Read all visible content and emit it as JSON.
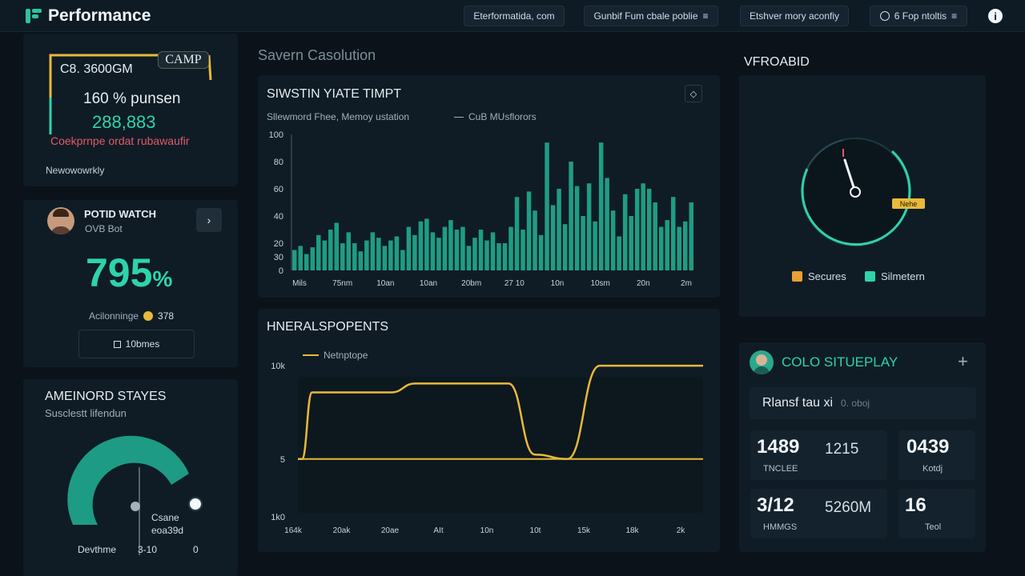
{
  "app": {
    "title": "Performance"
  },
  "header": {
    "pill1": "Eterformatida, com",
    "pill2": "Gunbif Fum cbale poblie",
    "pill3": "Etshver mory aconfiy",
    "pill4": "6 Fop ntoltis"
  },
  "camp_card": {
    "badge": "CAMP",
    "line1": "C8. 3600GM",
    "line2": "160 % punsen",
    "value": "288,883",
    "alert": "Coekprnpe ordat rubawaufir",
    "footer": "Newowowrkly"
  },
  "watch_card": {
    "title": "POTID WATCH",
    "subtitle": "OVB Bot",
    "percent": "795",
    "percent_sign": "%",
    "meta_label": "Acilonninge",
    "meta_value": "378",
    "button": "10bmes"
  },
  "stays_card": {
    "title": "AMEINORD STAYES",
    "subtitle": "Susclestt lifendun",
    "value_label": "Csane",
    "value": "eoa39d",
    "footer_left": "Devthme",
    "footer_mid": "3-10",
    "footer_right": "0",
    "gauge_fraction": 0.62
  },
  "section_title": "Savern Casolution",
  "bar_chart_panel": {
    "title": "SIWSTIN YIATE TIMPT",
    "legend_left": "Sllewmord Fhee, Memoy ustation",
    "legend_right": "CuB MUsflorors"
  },
  "line_chart_panel": {
    "title": "HNERALSPOPENTS",
    "legend": "Netnptope"
  },
  "gauge_panel": {
    "title": "VFROABID",
    "badge": "Nehe",
    "legend_a": "Secures",
    "legend_b": "Silmetern",
    "fraction": 0.78
  },
  "stats_panel": {
    "title": "COLO SITUEPLAY",
    "add": "+",
    "input_label": "Rlansf tau xi",
    "input_hint": "0. oboj",
    "cards": [
      {
        "big": "1489",
        "mid": "1215",
        "small": "TNCLEE"
      },
      {
        "big": "0439",
        "mid": "",
        "small": "Kotdj"
      },
      {
        "big": "3/12",
        "mid": "5260M",
        "small": "HMMGS"
      },
      {
        "big": "16",
        "mid": "",
        "small": "Teol"
      }
    ]
  },
  "colors": {
    "accent": "#2ed3ab",
    "bar": "#1f9c84",
    "line": "#e8b93a",
    "alert": "#e05a6a",
    "panel": "#0f1c25"
  },
  "chart_data": [
    {
      "type": "bar",
      "title": "SIWSTIN YIATE TIMPT",
      "ylim": [
        0,
        100
      ],
      "yticks": [
        0,
        20,
        30,
        40,
        60,
        80,
        100
      ],
      "xticks": [
        "Mils",
        "75nm",
        "10an",
        "10an",
        "20bm",
        "27 10",
        "10n",
        "10sm",
        "20n",
        "2m"
      ],
      "values": [
        15,
        18,
        12,
        17,
        26,
        22,
        30,
        35,
        20,
        28,
        20,
        14,
        22,
        28,
        24,
        18,
        22,
        25,
        15,
        32,
        26,
        36,
        38,
        28,
        24,
        32,
        37,
        30,
        32,
        18,
        24,
        30,
        22,
        28,
        20,
        20,
        32,
        54,
        30,
        58,
        44,
        26,
        94,
        48,
        60,
        34,
        80,
        62,
        40,
        64,
        36,
        94,
        68,
        44,
        25,
        56,
        40,
        60,
        64,
        60,
        50,
        32,
        37,
        54,
        32,
        36,
        50
      ],
      "grid": false
    },
    {
      "type": "line",
      "title": "HNERALSPOPENTS",
      "xticks": [
        "164k",
        "20ak",
        "20ae",
        "AIt",
        "10n",
        "10t",
        "15k",
        "18k",
        "2k"
      ],
      "series": [
        {
          "name": "Netnptope",
          "x": [
            0.0,
            0.01,
            0.035,
            0.1,
            0.23,
            0.29,
            0.52,
            0.585,
            0.665,
            0.745,
            1.0
          ],
          "y": [
            5,
            5,
            80,
            80,
            80,
            90,
            90,
            10,
            5,
            110,
            110
          ]
        },
        {
          "x": [
            0.0,
            1.0
          ],
          "y": [
            5,
            5
          ]
        }
      ]
    }
  ]
}
